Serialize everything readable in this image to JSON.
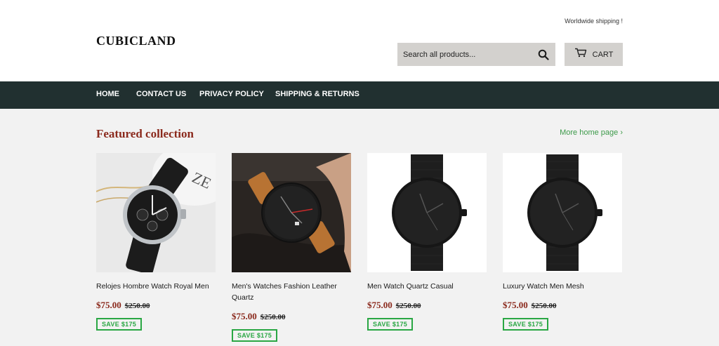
{
  "header": {
    "shipping_note": "Worldwide shipping !",
    "logo": "CUBICLAND",
    "search_placeholder": "Search all products...",
    "cart_label": "CART"
  },
  "nav": {
    "items": [
      {
        "label": "HOME"
      },
      {
        "label": "CONTACT US"
      },
      {
        "label": "PRIVACY POLICY"
      },
      {
        "label": "SHIPPING & RETURNS"
      }
    ]
  },
  "featured": {
    "title": "Featured collection",
    "more_link": "More home page ›",
    "products": [
      {
        "name": "Relojes Hombre Watch Royal Men",
        "price": "$75.00",
        "compare_price": "$250.00",
        "badge": "SAVE $175",
        "image": "silver-chronograph-watch"
      },
      {
        "name": "Men's Watches Fashion Leather Quartz",
        "price": "$75.00",
        "compare_price": "$250.00",
        "badge": "SAVE $175",
        "image": "leather-strap-watch-on-wrist"
      },
      {
        "name": "Men Watch Quartz Casual",
        "price": "$75.00",
        "compare_price": "$250.00",
        "badge": "SAVE $175",
        "image": "black-mesh-watch"
      },
      {
        "name": "Luxury Watch Men Mesh",
        "price": "$75.00",
        "compare_price": "$250.00",
        "badge": "SAVE $175",
        "image": "black-mesh-watch"
      }
    ]
  },
  "colors": {
    "nav_bg": "#213030",
    "accent_title": "#8b2a1d",
    "link_green": "#3d9a4a",
    "badge_green": "#2aa744"
  }
}
